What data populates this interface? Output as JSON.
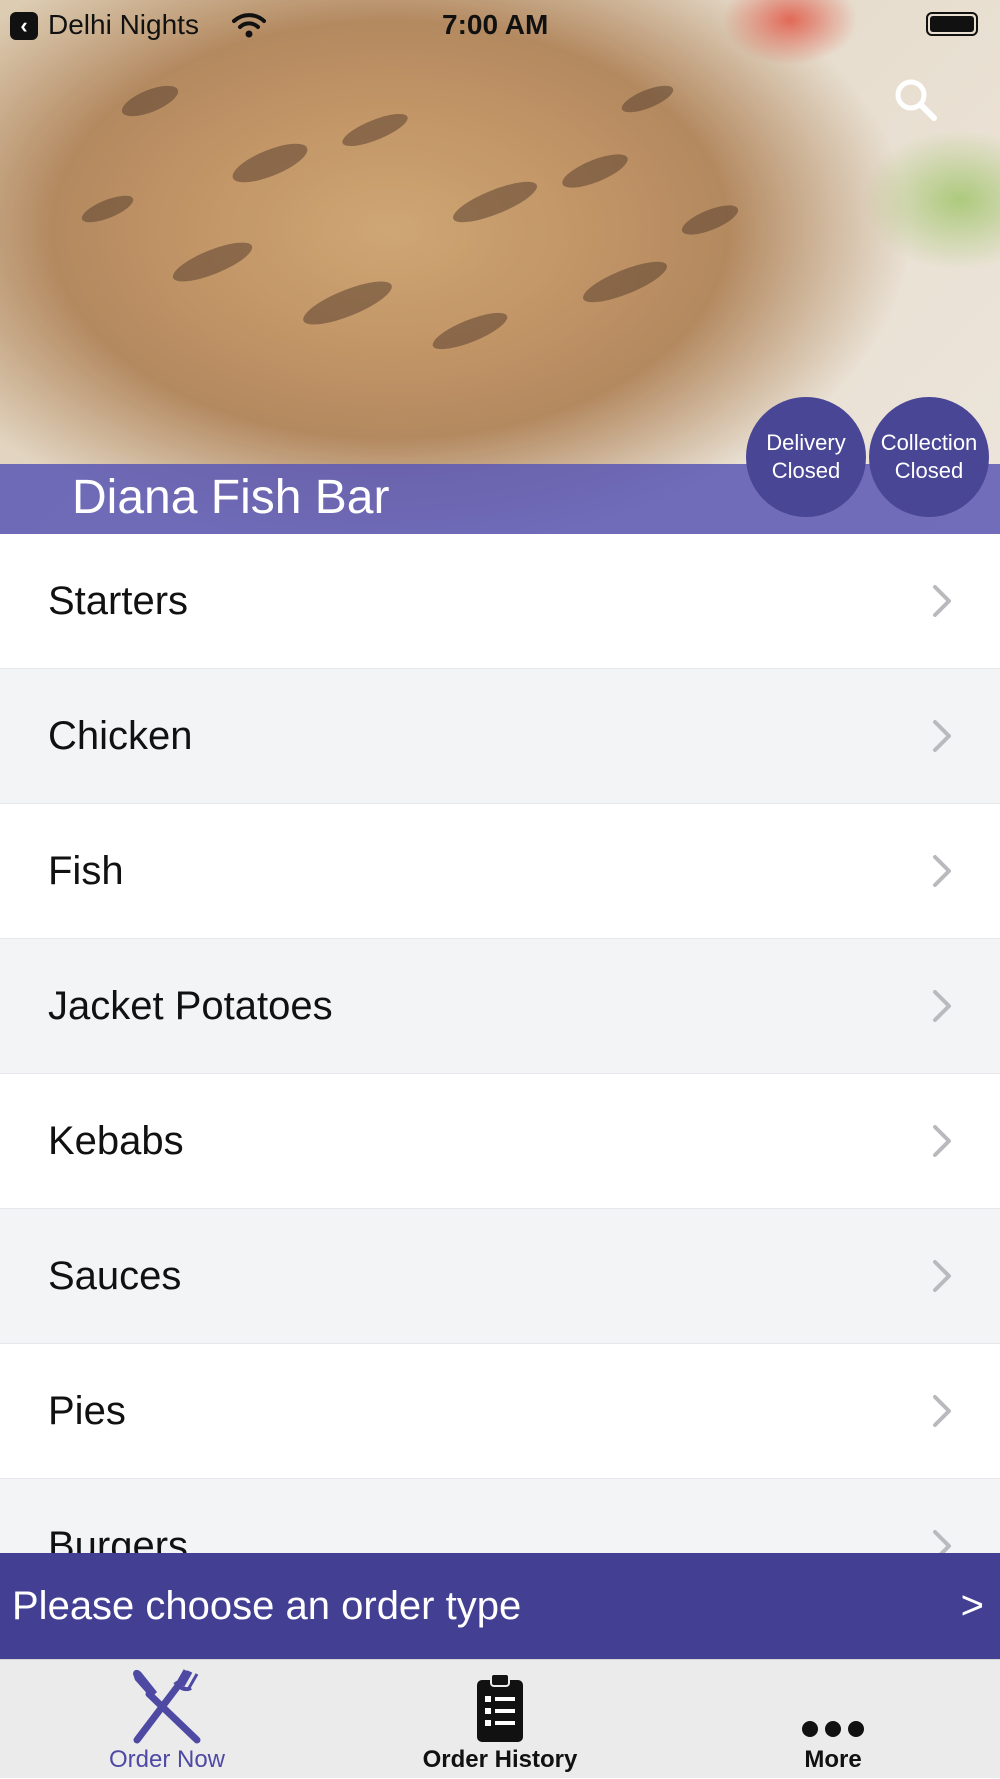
{
  "status_bar": {
    "back_app": "Delhi Nights",
    "time": "7:00 AM"
  },
  "restaurant": {
    "name": "Diana Fish Bar"
  },
  "service_status": {
    "delivery": {
      "line1": "Delivery",
      "line2": "Closed"
    },
    "collection": {
      "line1": "Collection",
      "line2": "Closed"
    }
  },
  "menu": {
    "categories": [
      "Starters",
      "Chicken",
      "Fish",
      "Jacket Potatoes",
      "Kebabs",
      "Sauces",
      "Pies",
      "Burgers"
    ]
  },
  "order_banner": {
    "text": "Please choose an order type",
    "arrow": ">"
  },
  "tabs": [
    {
      "label": "Order Now",
      "icon": "fork-knife-icon",
      "active": true
    },
    {
      "label": "Order History",
      "icon": "clipboard-list-icon",
      "active": false
    },
    {
      "label": "More",
      "icon": "more-dots-icon",
      "active": false
    }
  ],
  "colors": {
    "brand_purple": "#433f93",
    "active_tab": "#4e4aa3",
    "pill_bg": "#4a4696",
    "row_alt": "#f3f4f6"
  }
}
